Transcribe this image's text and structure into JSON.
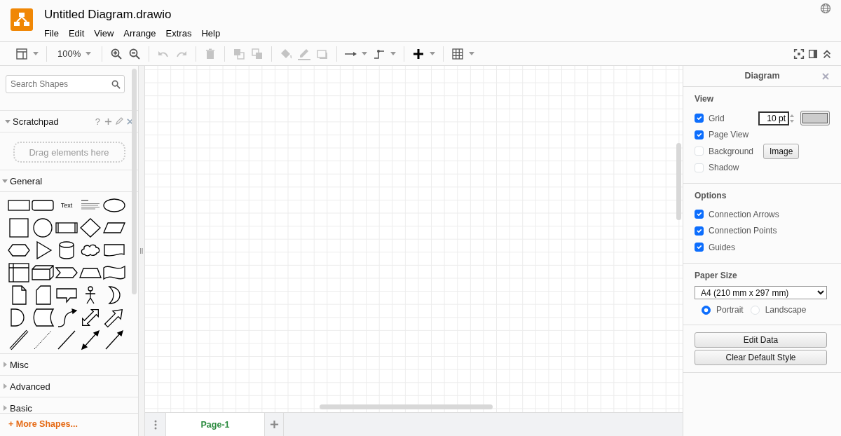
{
  "app": {
    "title": "Untitled Diagram.drawio"
  },
  "menu": [
    "File",
    "Edit",
    "View",
    "Arrange",
    "Extras",
    "Help"
  ],
  "toolbar": [
    {
      "kind": "format",
      "disabled": false,
      "menu": true
    },
    {
      "kind": "separator"
    },
    {
      "kind": "zoom",
      "label": "100%",
      "disabled": false,
      "menu": true
    },
    {
      "kind": "separator"
    },
    {
      "kind": "zoom-in",
      "disabled": false,
      "menu": false
    },
    {
      "kind": "zoom-out",
      "disabled": false,
      "menu": false
    },
    {
      "kind": "separator"
    },
    {
      "kind": "undo",
      "disabled": true,
      "menu": false
    },
    {
      "kind": "redo",
      "disabled": true,
      "menu": false
    },
    {
      "kind": "separator"
    },
    {
      "kind": "delete",
      "disabled": true,
      "menu": false
    },
    {
      "kind": "separator"
    },
    {
      "kind": "to-front",
      "disabled": true,
      "menu": false
    },
    {
      "kind": "to-back",
      "disabled": true,
      "menu": false
    },
    {
      "kind": "separator"
    },
    {
      "kind": "fill",
      "disabled": true,
      "menu": false
    },
    {
      "kind": "line-color",
      "disabled": true,
      "menu": false
    },
    {
      "kind": "shadow",
      "disabled": true,
      "menu": false
    },
    {
      "kind": "separator"
    },
    {
      "kind": "connection",
      "disabled": false,
      "menu": true
    },
    {
      "kind": "waypoints",
      "disabled": false,
      "menu": true
    },
    {
      "kind": "separator"
    },
    {
      "kind": "insert",
      "disabled": false,
      "menu": true
    },
    {
      "kind": "separator"
    },
    {
      "kind": "table",
      "disabled": false,
      "menu": true
    }
  ],
  "toolbar_right": [
    {
      "kind": "fullscreen"
    },
    {
      "kind": "panel"
    },
    {
      "kind": "collapse"
    }
  ],
  "sidebar": {
    "search": {
      "placeholder": "Search Shapes"
    },
    "sections": [
      {
        "kind": "scratchpad",
        "title": "Scratchpad",
        "expanded": true,
        "help": "?",
        "drop_hint": "Drag elements here"
      },
      {
        "kind": "shapes",
        "title": "General",
        "expanded": true,
        "shapes": [
          {
            "kind": "rect"
          },
          {
            "kind": "rounded"
          },
          {
            "kind": "text",
            "label": "Text"
          },
          {
            "kind": "heading"
          },
          {
            "kind": "ellipse"
          },
          {
            "kind": "square"
          },
          {
            "kind": "circle"
          },
          {
            "kind": "process"
          },
          {
            "kind": "diamond"
          },
          {
            "kind": "parallelogram"
          },
          {
            "kind": "hexagon"
          },
          {
            "kind": "triangle"
          },
          {
            "kind": "cylinder"
          },
          {
            "kind": "cloud"
          },
          {
            "kind": "document"
          },
          {
            "kind": "internal-storage"
          },
          {
            "kind": "cube"
          },
          {
            "kind": "step"
          },
          {
            "kind": "trapezoid"
          },
          {
            "kind": "tape"
          },
          {
            "kind": "note"
          },
          {
            "kind": "card"
          },
          {
            "kind": "callout"
          },
          {
            "kind": "actor"
          },
          {
            "kind": "or"
          },
          {
            "kind": "delay"
          },
          {
            "kind": "data-storage"
          },
          {
            "kind": "curve"
          },
          {
            "kind": "double-arrow"
          },
          {
            "kind": "arrow"
          },
          {
            "kind": "link"
          },
          {
            "kind": "dashed-line"
          },
          {
            "kind": "line"
          },
          {
            "kind": "double-connector"
          },
          {
            "kind": "connector"
          }
        ]
      },
      {
        "kind": "collapsed",
        "title": "Misc",
        "expanded": false
      },
      {
        "kind": "collapsed",
        "title": "Advanced",
        "expanded": false
      },
      {
        "kind": "collapsed",
        "title": "Basic",
        "expanded": false
      }
    ],
    "more_shapes": "+ More Shapes..."
  },
  "format_panel": {
    "title": "Diagram",
    "sections": [
      {
        "title": "View",
        "options": [
          {
            "kind": "grid",
            "label": "Grid",
            "checked": true,
            "value": "10 pt"
          },
          {
            "kind": "plain",
            "label": "Page View",
            "checked": true
          },
          {
            "kind": "image",
            "label": "Background",
            "checked": false,
            "button": "Image"
          },
          {
            "kind": "plain",
            "label": "Shadow",
            "checked": false
          }
        ]
      },
      {
        "title": "Options",
        "options": [
          {
            "kind": "plain",
            "label": "Connection Arrows",
            "checked": true
          },
          {
            "kind": "plain",
            "label": "Connection Points",
            "checked": true
          },
          {
            "kind": "plain",
            "label": "Guides",
            "checked": true
          }
        ]
      },
      {
        "title": "Paper Size",
        "paper": "A4 (210 mm x 297 mm)",
        "orientations": [
          {
            "label": "Portrait",
            "selected": true
          },
          {
            "label": "Landscape",
            "selected": false
          }
        ]
      }
    ],
    "buttons": [
      "Edit Data",
      "Clear Default Style"
    ]
  },
  "pages": [
    {
      "label": "Page-1",
      "selected": true
    }
  ]
}
